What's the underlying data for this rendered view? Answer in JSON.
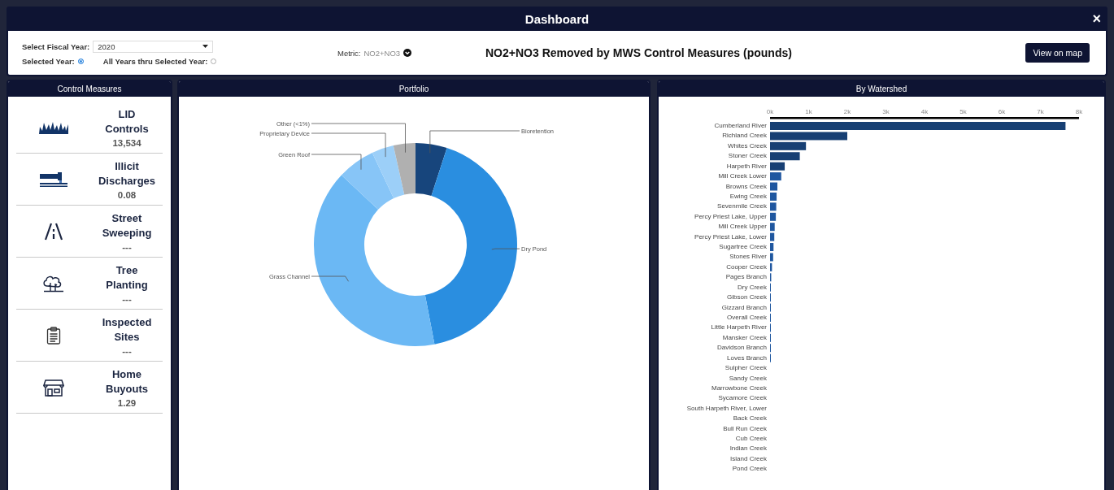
{
  "window": {
    "title": "Dashboard",
    "close": "×"
  },
  "filters": {
    "fiscal_year_label": "Select Fiscal Year:",
    "fiscal_year": "2020",
    "modes": [
      {
        "label": "Selected Year:",
        "selected": true
      },
      {
        "label": "All Years thru Selected Year:",
        "selected": false
      }
    ],
    "metric_label": "Metric:",
    "metric": "NO2+NO3"
  },
  "heading": "NO2+NO3 Removed by MWS Control Measures (pounds)",
  "map_button": "View on map",
  "control_measures": {
    "title": "Control Measures",
    "items": [
      {
        "kind": "lid",
        "name": "LID Controls",
        "value": "13,534"
      },
      {
        "kind": "discharge",
        "name": "Illicit Discharges",
        "value": "0.08"
      },
      {
        "kind": "street",
        "name": "Street Sweeping",
        "value": "---"
      },
      {
        "kind": "tree",
        "name": "Tree Planting",
        "value": "---"
      },
      {
        "kind": "inspection",
        "name": "Inspected Sites",
        "value": "---"
      },
      {
        "kind": "buyout",
        "name": "Home Buyouts",
        "value": "1.29"
      }
    ]
  },
  "portfolio": {
    "title": "Portfolio",
    "chart_data": {
      "type": "donut",
      "categories": [
        "Bioretention",
        "Dry Pond",
        "Grass Channel",
        "Green Roof",
        "Proprietary Device",
        "Other (<1%)"
      ],
      "values": [
        5,
        42,
        40,
        6,
        3.5,
        3.5
      ]
    }
  },
  "by_watershed": {
    "title": "By Watershed",
    "chart_data": {
      "type": "bar",
      "orientation": "horizontal",
      "xlim": [
        0,
        8000
      ],
      "xticks": [
        {
          "value": 0,
          "label": "0k"
        },
        {
          "value": 1000,
          "label": "1k"
        },
        {
          "value": 2000,
          "label": "2k"
        },
        {
          "value": 3000,
          "label": "3k"
        },
        {
          "value": 4000,
          "label": "4k"
        },
        {
          "value": 5000,
          "label": "5k"
        },
        {
          "value": 6000,
          "label": "6k"
        },
        {
          "value": 7000,
          "label": "7k"
        },
        {
          "value": 8000,
          "label": "8k"
        }
      ],
      "categories": [
        "Cumberland River",
        "Richland Creek",
        "Whites Creek",
        "Stoner Creek",
        "Harpeth River",
        "Mill Creek Lower",
        "Browns Creek",
        "Ewing Creek",
        "Sevenmile Creek",
        "Percy Priest Lake, Upper",
        "Mill Creek Upper",
        "Percy Priest Lake, Lower",
        "Sugartree Creek",
        "Stones River",
        "Cooper Creek",
        "Pages Branch",
        "Dry Creek",
        "Gibson Creek",
        "Gizzard Branch",
        "Overall Creek",
        "Little Harpeth River",
        "Mansker Creek",
        "Davidson Branch",
        "Loves Branch",
        "Sulpher Creek",
        "Sandy Creek",
        "Marrowbone Creek",
        "Sycamore Creek",
        "South Harpeth River, Lower",
        "Back Creek",
        "Bull Run Creek",
        "Cub Creek",
        "Indian Creek",
        "Island Creek",
        "Pond Creek"
      ],
      "values": [
        7650,
        2000,
        930,
        770,
        380,
        290,
        190,
        170,
        160,
        150,
        120,
        110,
        90,
        80,
        50,
        30,
        20,
        20,
        20,
        10,
        10,
        10,
        10,
        10,
        0,
        0,
        0,
        0,
        0,
        0,
        0,
        0,
        0,
        0,
        0
      ]
    }
  }
}
